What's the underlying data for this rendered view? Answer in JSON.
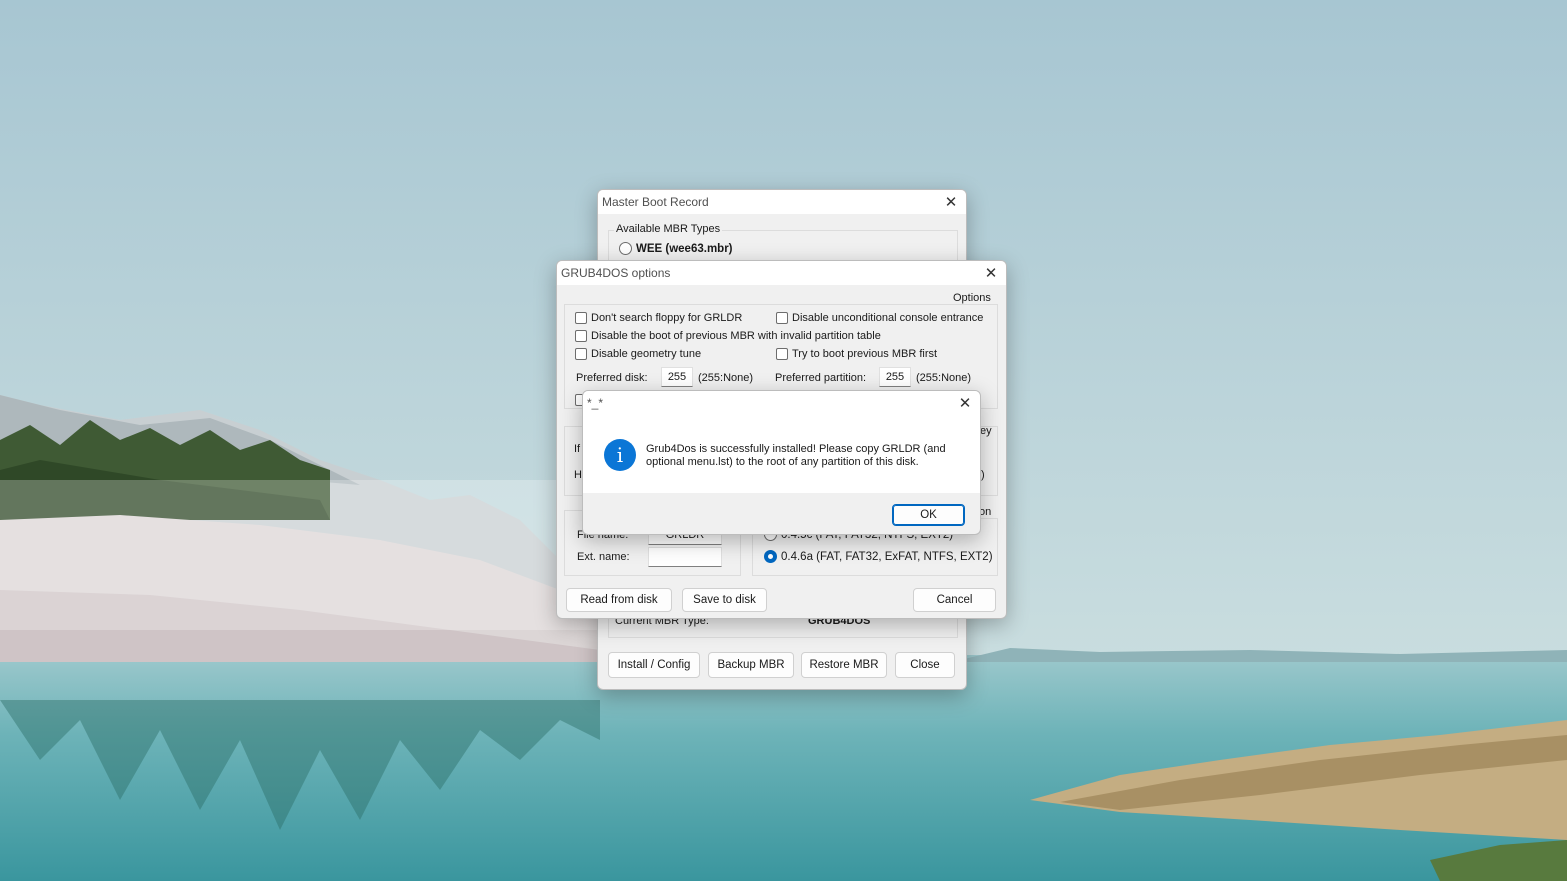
{
  "colors": {
    "accent": "#0067c0",
    "info_icon": "#0b76d6"
  },
  "mbr_window": {
    "title": "Master Boot Record",
    "group_label": "Available MBR Types",
    "first_option": "WEE (wee63.mbr)",
    "current_label": "Current MBR Type:",
    "current_value": "GRUB4DOS",
    "buttons": {
      "install": "Install / Config",
      "backup": "Backup MBR",
      "restore": "Restore MBR",
      "close": "Close"
    }
  },
  "grub_window": {
    "title": "GRUB4DOS options",
    "group_label": "Options",
    "checkboxes": {
      "no_floppy": "Don't search floppy for GRLDR",
      "disable_console": "Disable unconditional console entrance",
      "disable_prev_mbr": "Disable the boot of previous MBR with invalid partition table",
      "disable_geometry": "Disable geometry tune",
      "try_prev_mbr": "Try to boot previous MBR first"
    },
    "preferred_disk_label": "Preferred disk:",
    "preferred_disk_value": "255",
    "preferred_disk_hint": "(255:None)",
    "preferred_partition_label": "Preferred partition:",
    "preferred_partition_value": "255",
    "preferred_partition_hint": "(255:None)",
    "partial_if": "If",
    "partial_h": "H",
    "partial_ey": "ey",
    "partial_paren": ")",
    "partial_on": "on",
    "file_name_label": "File name:",
    "file_name_value": "GRLDR",
    "ext_name_label": "Ext. name:",
    "ext_name_value": "",
    "version_old": "0.4.5c (FAT, FAT32, NTFS, EXT2)",
    "version_new": "0.4.6a (FAT, FAT32, ExFAT, NTFS, EXT2)",
    "buttons": {
      "read": "Read from disk",
      "save": "Save to disk",
      "cancel": "Cancel"
    }
  },
  "message_box": {
    "title": "*_*",
    "message": "Grub4Dos is successfully installed! Please copy GRLDR (and optional menu.lst) to the root of any partition of this disk.",
    "ok": "OK",
    "icon": "info-icon"
  }
}
